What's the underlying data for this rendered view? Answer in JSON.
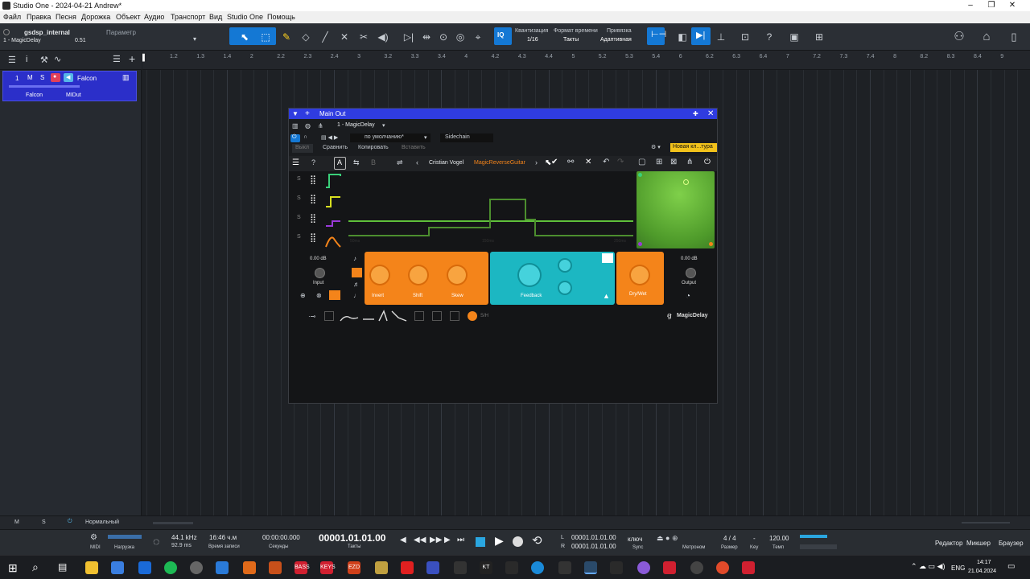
{
  "window": {
    "title": "Studio One - 2024-04-21 Andrew*"
  },
  "menu": [
    "Файл",
    "Правка",
    "Песня",
    "Дорожка",
    "Объект",
    "Аудио",
    "Транспорт",
    "Вид",
    "Studio One",
    "Помощь"
  ],
  "toolbar": {
    "device": "gsdsp_internal",
    "instance": "1 - MagicDelay",
    "value": "0.51",
    "param": "Параметр",
    "quantize_label": "Квантизация",
    "quantize_value": "1/16",
    "timebase_label": "Формат времени",
    "timebase_value": "Такты",
    "snap_label": "Привязка",
    "snap_value": "Адаптивная",
    "iq": "IQ"
  },
  "ruler": {
    "ticks": [
      "1.2",
      "1.3",
      "1.4",
      "2",
      "2.2",
      "2.3",
      "2.4",
      "3",
      "3.2",
      "3.3",
      "3.4",
      "4",
      "4.2",
      "4.3",
      "4.4",
      "5",
      "5.2",
      "5.3",
      "5.4",
      "6",
      "6.2",
      "6.3",
      "6.4",
      "7",
      "7.2",
      "7.3",
      "7.4",
      "8",
      "8.2",
      "8.3",
      "8.4",
      "9"
    ]
  },
  "track": {
    "num": "1",
    "m": "M",
    "s": "S",
    "name": "Falcon",
    "instrument": "Falcon",
    "output": "MIDut"
  },
  "plugin": {
    "route": "Main Out",
    "instance": "1 - MagicDelay",
    "preset": "по умолчанию*",
    "sidechain": "Sidechain",
    "off": "Выкл",
    "compare": "Сравнить",
    "copy": "Копировать",
    "paste": "Вставить",
    "new_preset": "Новая кл...тура",
    "author": "Cristian Vogel",
    "preset_name": "MagicReverseGuitar",
    "tab_a": "A",
    "tab_b": "B",
    "s_labels": [
      "S",
      "S",
      "S",
      "S"
    ],
    "input_db": "0.00 dB",
    "input": "Input",
    "output_db": "0.00 dB",
    "output": "Output",
    "invert": "Invert",
    "shift": "Shift",
    "skew": "Skew",
    "feedback": "Feedback",
    "drywet": "Dry/Wet",
    "sh": "S/H",
    "brand": "MagicDelay",
    "axis_left": "50ms",
    "axis_mid": "150ms",
    "axis_right": "250ms"
  },
  "arrstatus": {
    "m": "M",
    "s": "S",
    "mode": "Нормальный"
  },
  "transport": {
    "midi": "MIDI",
    "load": "Нагрузка",
    "sr": "44.1 kHz",
    "latency": "92.9 ms",
    "rec_time": "16:46 ч.м",
    "rec_label": "Время записи",
    "seconds": "00:00:00.000",
    "seconds_label": "Секунды",
    "bars": "00001.01.01.00",
    "bars_label": "Такты",
    "l": "L",
    "r": "R",
    "loop_l": "00001.01.01.00",
    "loop_r": "00001.01.01.00",
    "sync_state": "ключ",
    "sync": "Sync",
    "metronome": "Метроном",
    "sig": "4 / 4",
    "sig_label": "Размер",
    "key": "-",
    "key_label": "Key",
    "tempo": "120.00",
    "tempo_label": "Темп",
    "editor": "Редактор",
    "mixer": "Микшер",
    "browser": "Браузер"
  },
  "taskbar": {
    "lang": "ENG",
    "time": "14:17",
    "date": "21.04.2024",
    "bass": "BASS",
    "keys": "KEYS",
    "dz": "EZD",
    "kt": "KT"
  },
  "colors": {
    "accent": "#1478d4",
    "orange": "#f4841a",
    "teal": "#1cb7c2",
    "green": "#5fbf3a",
    "track": "#2b2fc9"
  }
}
